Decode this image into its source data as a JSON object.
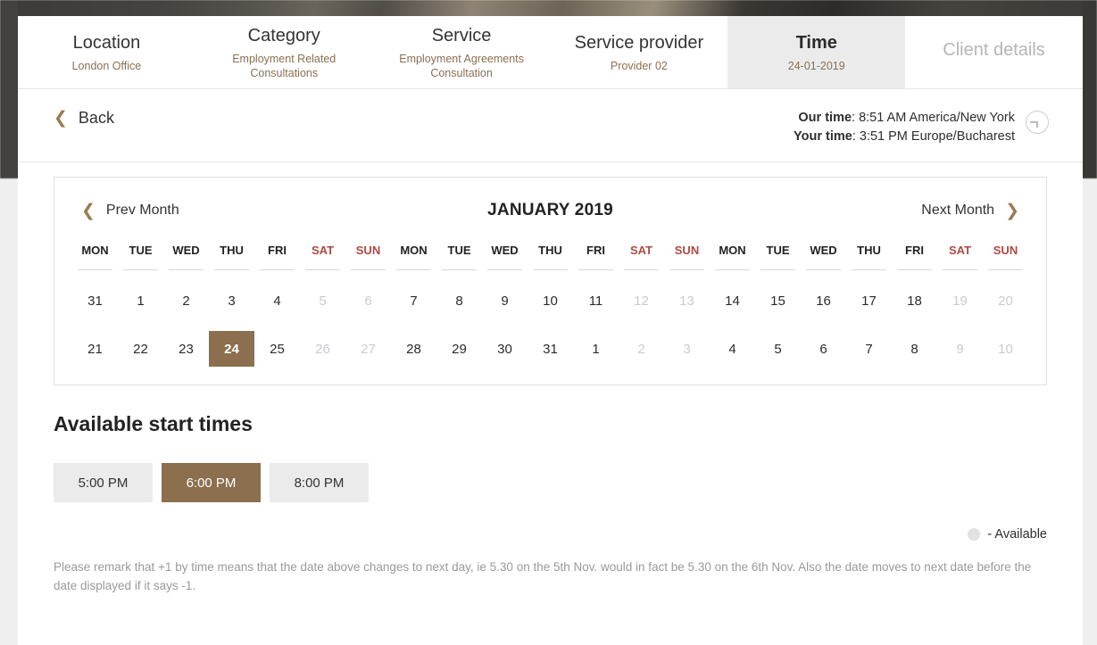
{
  "theme": {
    "accent_brown": "#8b6f4e",
    "weekend_red": "#b04a44",
    "muted_gray": "#c9cbcf",
    "slot_bg": "#ebebeb"
  },
  "steps": [
    {
      "title": "Location",
      "sub": "London Office",
      "state": "done"
    },
    {
      "title": "Category",
      "sub": "Employment Related Consultations",
      "state": "done"
    },
    {
      "title": "Service",
      "sub": "Employment Agreements Consultation",
      "state": "done"
    },
    {
      "title": "Service provider",
      "sub": "Provider 02",
      "state": "done"
    },
    {
      "title": "Time",
      "sub": "24-01-2019",
      "state": "active"
    },
    {
      "title": "Client details",
      "sub": "",
      "state": "disabled"
    }
  ],
  "subbar": {
    "back_label": "Back",
    "back_icon": "chevron-left-icon",
    "clock_icon": "clock-icon",
    "our_time_label": "Our time",
    "our_time_value": "8:51 AM America/New York",
    "your_time_label": "Your time",
    "your_time_value": "3:51 PM Europe/Bucharest"
  },
  "calendar": {
    "prev_label": "Prev Month",
    "next_label": "Next Month",
    "prev_icon": "chevron-left-icon",
    "next_icon": "chevron-right-icon",
    "month_title": "JANUARY 2019",
    "weekdays": [
      "MON",
      "TUE",
      "WED",
      "THU",
      "FRI",
      "SAT",
      "SUN",
      "MON",
      "TUE",
      "WED",
      "THU",
      "FRI",
      "SAT",
      "SUN",
      "MON",
      "TUE",
      "WED",
      "THU",
      "FRI",
      "SAT",
      "SUN"
    ],
    "weekend_indexes": [
      5,
      6,
      12,
      13,
      19,
      20
    ],
    "rows": [
      [
        "31",
        "1",
        "2",
        "3",
        "4",
        "5",
        "6",
        "7",
        "8",
        "9",
        "10",
        "11",
        "12",
        "13",
        "14",
        "15",
        "16",
        "17",
        "18",
        "19",
        "20"
      ],
      [
        "21",
        "22",
        "23",
        "24",
        "25",
        "26",
        "27",
        "28",
        "29",
        "30",
        "31",
        "1",
        "2",
        "3",
        "4",
        "5",
        "6",
        "7",
        "8",
        "9",
        "10"
      ]
    ],
    "muted_cells": [
      [
        5,
        6,
        12,
        13,
        19,
        20
      ],
      [
        5,
        6,
        12,
        13,
        19,
        20
      ]
    ],
    "selected": {
      "row": 1,
      "col": 3,
      "value": "24"
    }
  },
  "times": {
    "heading": "Available start times",
    "slots": [
      {
        "label": "5:00 PM",
        "selected": false
      },
      {
        "label": "6:00 PM",
        "selected": true
      },
      {
        "label": "8:00 PM",
        "selected": false
      }
    ],
    "legend_text": "- Available",
    "legend_swatch": "available-circle-swatch"
  },
  "footnote": "Please remark that +1 by time means that the date above changes to next day, ie 5.30 on the 5th Nov. would in fact be 5.30 on the 6th Nov. Also the date moves to next date before the date displayed if it says -1."
}
